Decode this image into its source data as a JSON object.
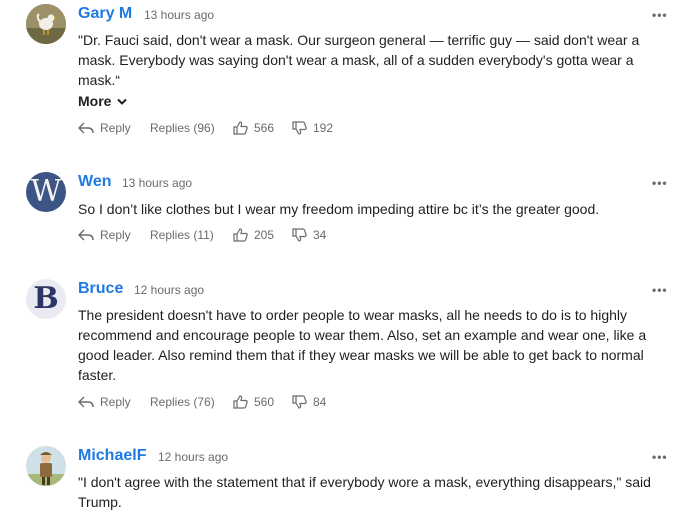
{
  "comments": [
    {
      "name": "Gary M",
      "time": "13 hours ago",
      "text": "\"Dr. Fauci said, don't wear a mask. Our surgeon general — terrific guy — said don't wear a mask. Everybody was saying don't wear a mask, all of a sudden everybody's gotta wear a mask.“",
      "more_label": "More",
      "reply_label": "Reply",
      "replies_label": "Replies (96)",
      "likes": "566",
      "dislikes": "192"
    },
    {
      "name": "Wen",
      "time": "13 hours ago",
      "avatar_letter": "W",
      "text": "So I don’t like clothes but I wear my freedom impeding attire bc it’s the greater good.",
      "reply_label": "Reply",
      "replies_label": "Replies (11)",
      "likes": "205",
      "dislikes": "34"
    },
    {
      "name": "Bruce",
      "time": "12 hours ago",
      "avatar_letter": "B",
      "text": "The president doesn't have to order people to wear masks, all he needs to do is to highly recommend and encourage people to wear them. Also, set an example and wear one, like a good leader. Also remind them that if they wear masks we will be able to get back to normal faster.",
      "reply_label": "Reply",
      "replies_label": "Replies (76)",
      "likes": "560",
      "dislikes": "84"
    },
    {
      "name": "MichaelF",
      "time": "12 hours ago",
      "text": "\"I don't agree with the statement that if everybody wore a mask, everything disappears,\" said Trump."
    }
  ],
  "colors": {
    "name": "#1f7ae0",
    "meta": "#6b6b6b",
    "text": "#1f1f1f"
  },
  "icons": {
    "menu": "more-dots-icon",
    "reply": "reply-arrow-icon",
    "like": "thumbs-up-icon",
    "dislike": "thumbs-down-icon"
  }
}
